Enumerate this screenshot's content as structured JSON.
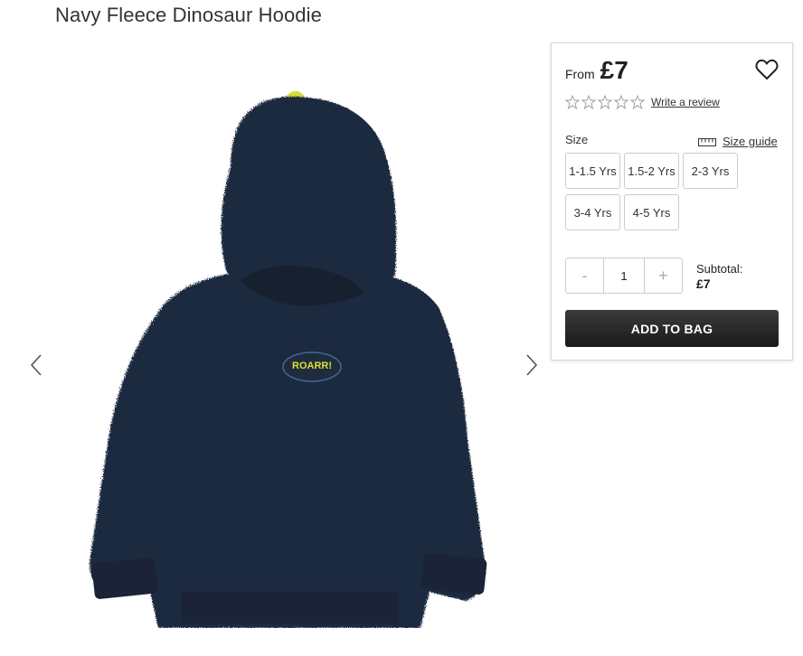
{
  "product": {
    "title": "Navy Fleece Dinosaur Hoodie",
    "image_alt": "Navy fleece dinosaur hoodie",
    "badge_text": "ROARR!"
  },
  "pricing": {
    "from_label": "From",
    "price": "£7"
  },
  "rating": {
    "stars_filled": 0,
    "stars_total": 5,
    "review_link": "Write a review"
  },
  "size": {
    "label": "Size",
    "guide_link": "Size guide",
    "options": [
      "1-1.5 Yrs",
      "1.5-2 Yrs",
      "2-3 Yrs",
      "3-4 Yrs",
      "4-5 Yrs"
    ]
  },
  "quantity": {
    "minus": "-",
    "value": "1",
    "plus": "+"
  },
  "subtotal": {
    "label": "Subtotal:",
    "amount": "£7"
  },
  "cart": {
    "add_label": "ADD TO BAG"
  },
  "colors": {
    "navy": "#1e2a3f",
    "accent_yellow": "#d7e03a",
    "button_dark": "#222222"
  },
  "icons": [
    "chevron-left-icon",
    "chevron-right-icon",
    "heart-icon",
    "star-outline-icon",
    "ruler-icon"
  ]
}
